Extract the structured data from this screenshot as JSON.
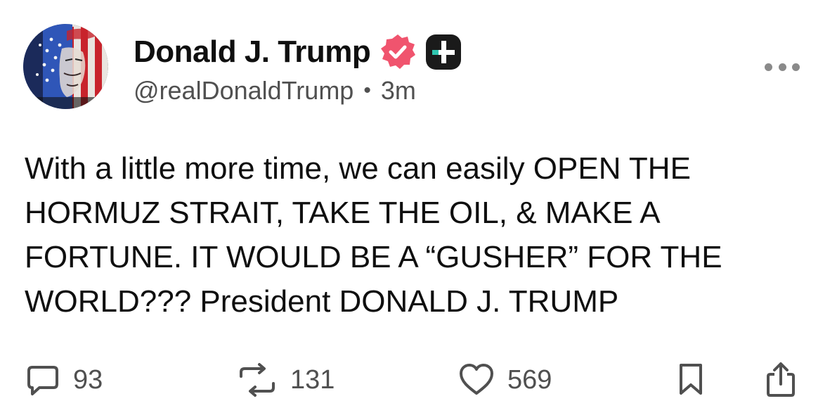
{
  "author": {
    "display_name": "Donald J. Trump",
    "handle": "@realDonaldTrump",
    "separator": "•",
    "time_ago": "3m",
    "verified_badge_color": "#f0546e"
  },
  "post": {
    "text": "With a little more time, we can easily OPEN THE\nHORMUZ STRAIT, TAKE THE OIL, & MAKE A\nFORTUNE. IT WOULD BE A “GUSHER” FOR THE\nWORLD??? President DONALD J. TRUMP"
  },
  "actions": {
    "replies": "93",
    "reposts": "131",
    "likes": "569"
  },
  "icons": {
    "verified": "verified-badge-icon",
    "plus": "plus-badge-icon",
    "more": "more-options-icon",
    "reply": "speech-bubble-icon",
    "repost": "repost-arrows-icon",
    "like": "heart-icon",
    "bookmark": "bookmark-icon",
    "share": "share-icon"
  },
  "colors": {
    "text": "#0f0f0f",
    "muted": "#505050",
    "verified": "#f0546e",
    "plus_badge": "#1a1a1a",
    "plus_accent": "#2fc6b0"
  }
}
